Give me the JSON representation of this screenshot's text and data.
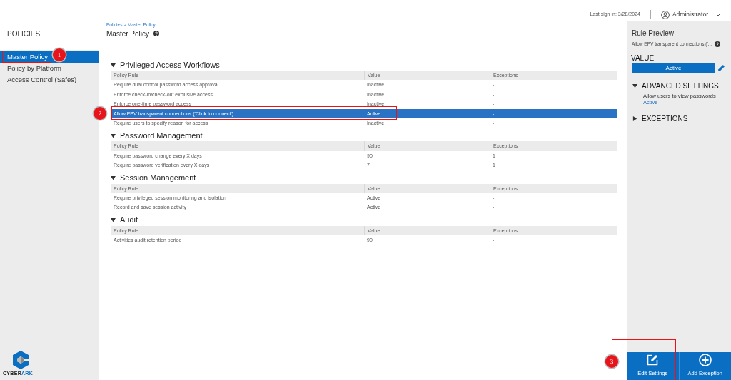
{
  "header": {
    "last_sign_in": "Last sign in: 3/28/2024",
    "user": "Administrator"
  },
  "sidebar": {
    "title": "POLICIES",
    "items": [
      {
        "label": "Master Policy",
        "selected": true
      },
      {
        "label": "Policy by Platform",
        "selected": false
      },
      {
        "label": "Access Control (Safes)",
        "selected": false
      }
    ],
    "logo": {
      "text_1": "CYBER",
      "text_2": "ARK"
    }
  },
  "page": {
    "breadcrumb": "Policies > Master Policy",
    "title": "Master Policy"
  },
  "groups": [
    {
      "title": "Privileged Access Workflows",
      "expanded": true,
      "columns": [
        "Policy Rule",
        "Value",
        "Exceptions"
      ],
      "rows": [
        {
          "rule": "Require dual control password access approval",
          "value": "Inactive",
          "exceptions": "-",
          "selected": false
        },
        {
          "rule": "Enforce check-in/check-out exclusive access",
          "value": "Inactive",
          "exceptions": "-",
          "selected": false
        },
        {
          "rule": "Enforce one-time password access",
          "value": "Inactive",
          "exceptions": "-",
          "selected": false
        },
        {
          "rule": "Allow EPV transparent connections ('Click to connect')",
          "value": "Active",
          "exceptions": "-",
          "selected": true
        },
        {
          "rule": "Require users to specify reason for access",
          "value": "Inactive",
          "exceptions": "-",
          "selected": false
        }
      ]
    },
    {
      "title": "Password Management",
      "expanded": true,
      "columns": [
        "Policy Rule",
        "Value",
        "Exceptions"
      ],
      "rows": [
        {
          "rule": "Require password change every X days",
          "value": "90",
          "exceptions": "1",
          "selected": false
        },
        {
          "rule": "Require password verification every X days",
          "value": "7",
          "exceptions": "1",
          "selected": false
        }
      ]
    },
    {
      "title": "Session Management",
      "expanded": true,
      "columns": [
        "Policy Rule",
        "Value",
        "Exceptions"
      ],
      "rows": [
        {
          "rule": "Require privileged session monitoring and isolation",
          "value": "Active",
          "exceptions": "-",
          "selected": false
        },
        {
          "rule": "Record and save session activity",
          "value": "Active",
          "exceptions": "-",
          "selected": false
        }
      ]
    },
    {
      "title": "Audit",
      "expanded": true,
      "columns": [
        "Policy Rule",
        "Value",
        "Exceptions"
      ],
      "rows": [
        {
          "rule": "Activities audit retention period",
          "value": "90",
          "exceptions": "-",
          "selected": false
        }
      ]
    }
  ],
  "preview": {
    "title": "Rule Preview",
    "subtitle": "Allow EPV transparent connections ('...",
    "value_label": "VALUE",
    "value": "Active",
    "sections": [
      {
        "title": "ADVANCED SETTINGS",
        "expanded": true,
        "lines": [
          {
            "label": "Allow users to view passwords",
            "value": "Active"
          }
        ]
      },
      {
        "title": "EXCEPTIONS",
        "expanded": false
      }
    ]
  },
  "actions": [
    {
      "kind": "edit",
      "label": "Edit Settings"
    },
    {
      "kind": "add",
      "label": "Add Exception"
    }
  ],
  "annotations": [
    {
      "kind": "sidebar",
      "number": "1"
    },
    {
      "kind": "row",
      "number": "2"
    },
    {
      "kind": "action",
      "number": "3"
    }
  ]
}
